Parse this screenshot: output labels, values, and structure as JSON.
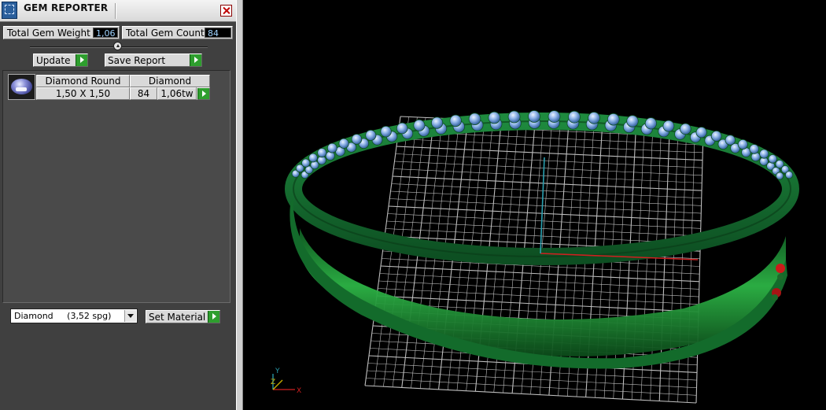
{
  "window": {
    "title": "GEM REPORTER"
  },
  "stats": {
    "total_weight_label": "Total Gem Weight",
    "total_weight_value": "1,06",
    "total_count_label": "Total Gem Count",
    "total_count_value": "84"
  },
  "actions": {
    "update_label": "Update",
    "save_report_label": "Save Report"
  },
  "report": {
    "columns": [
      "Diamond Round",
      "Diamond"
    ],
    "rows": [
      {
        "shape": "Diamond Round",
        "material": "Diamond",
        "size": "1,50 X 1,50",
        "count": "84",
        "weight": "1,06tw",
        "thumbnail_icon": "round-gem-icon"
      }
    ]
  },
  "material": {
    "selected": "Diamond     (3,52 spg)",
    "set_label": "Set Material"
  },
  "viewport": {
    "axis_labels": {
      "x": "X",
      "y": "Y",
      "z": "Z"
    },
    "colors": {
      "background": "#000000",
      "grid": "#bfbfbf",
      "ring": "#1f8a3a",
      "gems": "#8fb4e8",
      "axis_x": "#d02020",
      "axis_y": "#2aa0b0",
      "axis_z": "#c8b000"
    },
    "icons": [
      "ring-model",
      "construction-grid",
      "axis-triad-icon"
    ]
  },
  "colors": {
    "panel_bg": "#404040",
    "value_text": "#9fd3ff",
    "go_button": "#2e9e2e"
  }
}
